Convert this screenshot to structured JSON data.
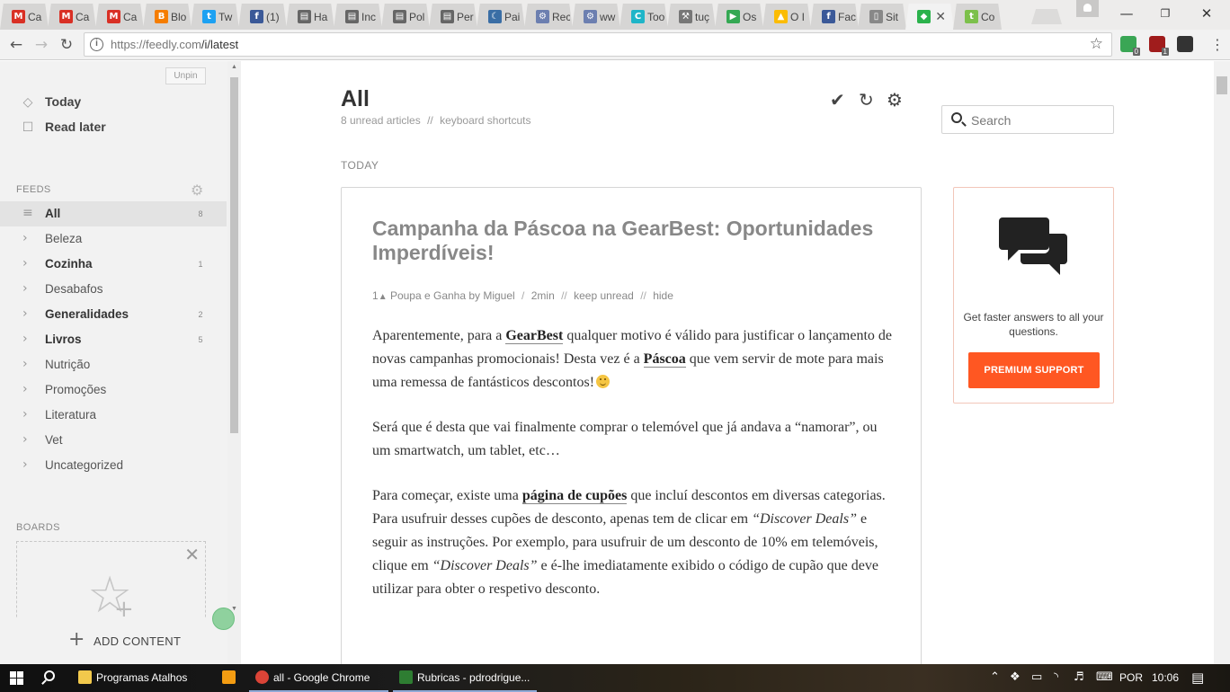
{
  "browser": {
    "tabs": [
      {
        "title": "Ca",
        "icon": "gmail-icon",
        "color": "#d93025"
      },
      {
        "title": "Ca",
        "icon": "gmail-icon",
        "color": "#d93025"
      },
      {
        "title": "Ca",
        "icon": "gmail-icon",
        "color": "#d93025"
      },
      {
        "title": "Blo",
        "icon": "blogger-icon",
        "color": "#f57d00"
      },
      {
        "title": "Tw",
        "icon": "twitter-icon",
        "color": "#1da1f2"
      },
      {
        "title": "(1)",
        "icon": "facebook-icon",
        "color": "#3b5998"
      },
      {
        "title": "Ha",
        "icon": "page-icon",
        "color": "#666666"
      },
      {
        "title": "Inc",
        "icon": "page-icon",
        "color": "#666666"
      },
      {
        "title": "Pol",
        "icon": "page-icon",
        "color": "#666666"
      },
      {
        "title": "Per",
        "icon": "page-icon",
        "color": "#666666"
      },
      {
        "title": "Pai",
        "icon": "moon-icon",
        "color": "#3a6ea5"
      },
      {
        "title": "Rec",
        "icon": "gear-favicon-icon",
        "color": "#6c7fb0"
      },
      {
        "title": "ww",
        "icon": "gear-favicon-icon",
        "color": "#6c7fb0"
      },
      {
        "title": "Too",
        "icon": "c-icon",
        "color": "#1fb5c8"
      },
      {
        "title": "tuç",
        "icon": "tool-icon",
        "color": "#777777"
      },
      {
        "title": "Os",
        "icon": "play-icon",
        "color": "#34a853"
      },
      {
        "title": "O I",
        "icon": "drive-icon",
        "color": "#fbbc04"
      },
      {
        "title": "Fac",
        "icon": "facebook-icon",
        "color": "#3b5998"
      },
      {
        "title": "Sit",
        "icon": "doc-icon",
        "color": "#888888"
      },
      {
        "title": "",
        "icon": "feedly-icon",
        "color": "#2bb24c",
        "active": true
      },
      {
        "title": "Co",
        "icon": "t-icon",
        "color": "#7cc04b"
      }
    ],
    "url_host": "https://feedly.com",
    "url_path": "/i/latest",
    "extensions": [
      {
        "icon": "green-ext-icon",
        "badge": "0",
        "color": "#3aa655"
      },
      {
        "icon": "ublock-icon",
        "badge": "1",
        "color": "#a01c1c"
      },
      {
        "icon": "film-ext-icon",
        "badge": "",
        "color": "#333333"
      }
    ]
  },
  "sidebar": {
    "unpin": "Unpin",
    "nav": [
      {
        "label": "Today",
        "icon": "today-icon"
      },
      {
        "label": "Read later",
        "icon": "bookmark-icon"
      }
    ],
    "feeds_label": "FEEDS",
    "feeds": [
      {
        "name": "All",
        "count": "8",
        "bold": true,
        "selected": true
      },
      {
        "name": "Beleza",
        "count": "",
        "bold": false
      },
      {
        "name": "Cozinha",
        "count": "1",
        "bold": true
      },
      {
        "name": "Desabafos",
        "count": "",
        "bold": false
      },
      {
        "name": "Generalidades",
        "count": "2",
        "bold": true
      },
      {
        "name": "Livros",
        "count": "5",
        "bold": true
      },
      {
        "name": "Nutrição",
        "count": "",
        "bold": false
      },
      {
        "name": "Promoções",
        "count": "",
        "bold": false
      },
      {
        "name": "Literatura",
        "count": "",
        "bold": false
      },
      {
        "name": "Vet",
        "count": "",
        "bold": false
      },
      {
        "name": "Uncategorized",
        "count": "",
        "bold": false
      }
    ],
    "boards_label": "BOARDS",
    "add_content": "ADD CONTENT"
  },
  "main": {
    "title": "All",
    "unread": "8 unread articles",
    "shortcuts": "keyboard shortcuts",
    "separator": "//",
    "search_placeholder": "Search",
    "today_label": "TODAY",
    "article": {
      "title": "Campanha da Páscoa na GearBest: Oportunidades Imperdíveis!",
      "popularity": "1",
      "source": "Poupa e Ganha by Miguel",
      "time": "2min",
      "keep_unread": "keep unread",
      "hide": "hide",
      "slash": "/",
      "p1_a": "Aparentemente, para a ",
      "p1_link1": "GearBest",
      "p1_b": " qualquer motivo é válido para justificar o lançamento de novas campanhas promocionais! Desta vez é a ",
      "p1_link2": "Páscoa",
      "p1_c": " que vem servir de mote para mais uma remessa de fantásticos descontos!",
      "p2": "Será que é desta que vai finalmente comprar o telemóvel que já andava a “namorar”, ou um smartwatch, um tablet, etc…",
      "p3_a": "Para começar, existe uma ",
      "p3_link": "página de cupões",
      "p3_b": " que incluí descontos em diversas categorias. Para usufruir desses cupões de desconto, apenas tem de clicar em ",
      "p3_em1": "“Discover Deals”",
      "p3_c": " e seguir as instruções. Por exemplo, para usufruir de um desconto de 10% em telemóveis, clique em ",
      "p3_em2": "“Discover Deals”",
      "p3_d": " e é-lhe imediatamente exibido o código de cupão que deve utilizar para obter o respetivo desconto."
    },
    "support": {
      "text": "Get faster answers to all your questions.",
      "button": "PREMIUM SUPPORT",
      "accent": "#ff5722"
    }
  },
  "taskbar": {
    "apps": [
      {
        "label": "Programas Atalhos",
        "icon": "folder-icon",
        "color": "#f2c94c"
      },
      {
        "label": "",
        "icon": "media-player-icon",
        "color": "#f39c12"
      },
      {
        "label": "all - Google Chrome",
        "icon": "chrome-icon",
        "color": "#db4437"
      },
      {
        "label": "Rubricas - pdrodrigue...",
        "icon": "sheets-icon",
        "color": "#2e7d32"
      }
    ],
    "language": "POR",
    "time": "10:06"
  }
}
